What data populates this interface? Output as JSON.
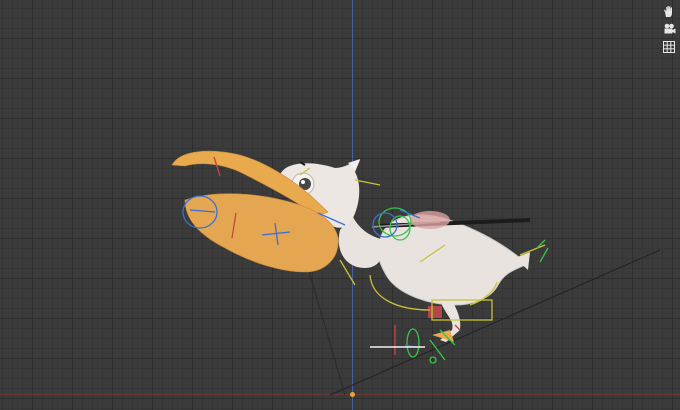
{
  "viewport": {
    "colors": {
      "background": "#3b3b3b",
      "grid": "#2e2e2e",
      "axis_z": "#4a6fbf",
      "axis_x": "#7a3b3b",
      "origin": "#e8a33a"
    }
  },
  "navigation_gizmo": {
    "buttons": [
      {
        "icon": "hand-pan-icon"
      },
      {
        "icon": "camera-view-icon"
      },
      {
        "icon": "grid-ortho-icon"
      }
    ]
  },
  "scene": {
    "object": "pelican-rig",
    "colors": {
      "body": "#e8e3de",
      "beak": "#e9a94d",
      "pouch": "#e4a650",
      "rig_yellow": "#c9c23a",
      "rig_green": "#39c44a",
      "rig_blue": "#3a6fd0",
      "rig_red": "#d04040",
      "rig_black": "#1c1c1c"
    }
  }
}
